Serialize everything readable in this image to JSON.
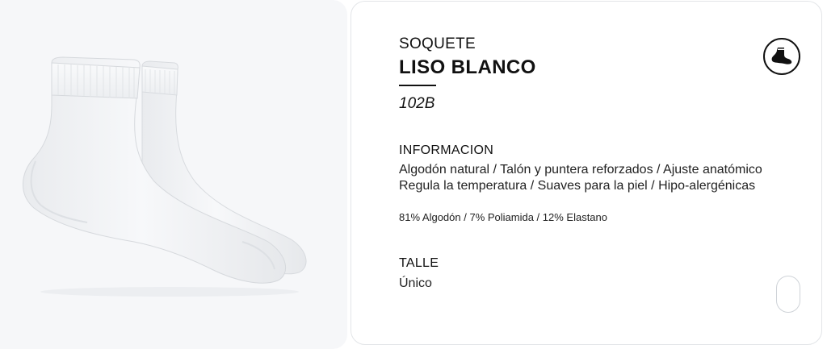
{
  "product": {
    "category": "SOQUETE",
    "name": "LISO BLANCO",
    "code": "102B",
    "image_alt": "white ankle socks"
  },
  "informacion": {
    "heading": "INFORMACION",
    "lines": [
      "Algodón natural / Talón y puntera reforzados / Ajuste anatómico",
      "Regula la temperatura / Suaves para la piel / Hipo-alergénicas"
    ],
    "composition": "81% Algodón / 7% Poliamida / 12% Elastano"
  },
  "talle": {
    "heading": "TALLE",
    "value": "Único"
  },
  "icons": {
    "sock_type": "ankle-sock-icon",
    "scroll": "scroll-pill"
  },
  "colors": {
    "image_background": "#f6f7f9",
    "card_border": "#e3e5e8",
    "text": "#111111",
    "sock": "#f4f5f7"
  }
}
